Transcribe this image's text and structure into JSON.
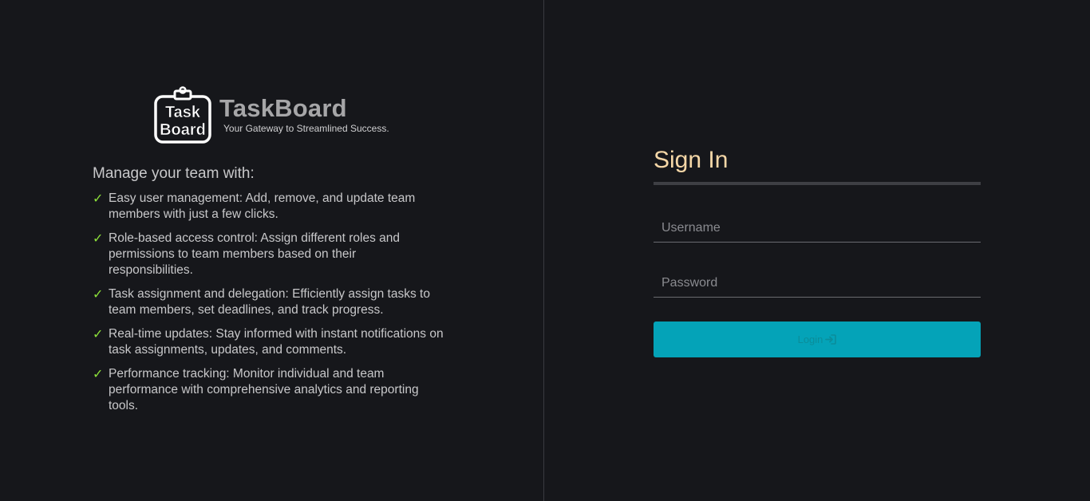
{
  "brand": {
    "title": "TaskBoard",
    "tagline": "Your Gateway to Streamlined Success.",
    "logo_text_line1": "Task",
    "logo_text_line2": "Board"
  },
  "features": {
    "heading": "Manage your team with:",
    "check_glyph": "✓",
    "items": [
      {
        "text": "Easy user management: Add, remove, and update team members with just a few clicks."
      },
      {
        "text": "Role-based access control: Assign different roles and permissions to team members based on their responsibilities."
      },
      {
        "text": "Task assignment and delegation: Efficiently assign tasks to team members, set deadlines, and track progress."
      },
      {
        "text": "Real-time updates: Stay informed with instant notifications on task assignments, updates, and comments."
      },
      {
        "text": "Performance tracking: Monitor individual and team performance with comprehensive analytics and reporting tools."
      }
    ]
  },
  "signin": {
    "title": "Sign In",
    "username_placeholder": "Username",
    "username_value": "",
    "password_placeholder": "Password",
    "password_value": "",
    "login_label": "Login"
  },
  "colors": {
    "background": "#16171b",
    "accent_button": "#04a3b8",
    "title_color": "#f5d7a7",
    "check_color": "#8ce03a"
  },
  "icons": {
    "check": "check-icon",
    "login": "sign-in-icon",
    "logo": "taskboard-clipboard-logo"
  }
}
